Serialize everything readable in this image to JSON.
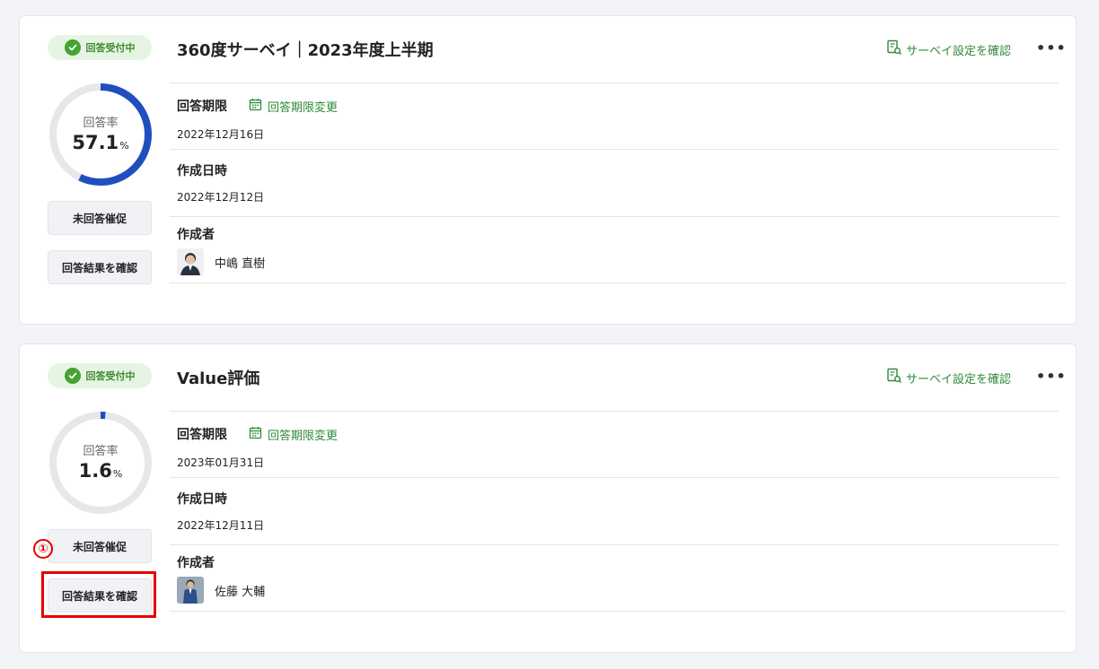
{
  "surveys": [
    {
      "status": "回答受付中",
      "title": "360度サーベイ｜2023年度上半期",
      "settings_link": "サーベイ設定を確認",
      "response_rate_label": "回答率",
      "response_rate_value": "57.1",
      "response_rate_unit": "%",
      "response_rate_fraction": 0.571,
      "remind_button": "未回答催促",
      "results_button": "回答結果を確認",
      "deadline_label": "回答期限",
      "deadline_change": "回答期限変更",
      "deadline_value": "2022年12月16日",
      "created_label": "作成日時",
      "created_value": "2022年12月12日",
      "creator_label": "作成者",
      "creator_name": "中嶋 直樹"
    },
    {
      "status": "回答受付中",
      "title": "Value評価",
      "settings_link": "サーベイ設定を確認",
      "response_rate_label": "回答率",
      "response_rate_value": "1.6",
      "response_rate_unit": "%",
      "response_rate_fraction": 0.016,
      "remind_button": "未回答催促",
      "results_button": "回答結果を確認",
      "deadline_label": "回答期限",
      "deadline_change": "回答期限変更",
      "deadline_value": "2023年01月31日",
      "created_label": "作成日時",
      "created_value": "2022年12月11日",
      "creator_label": "作成者",
      "creator_name": "佐藤 大輔"
    }
  ],
  "annotation": {
    "marker": "①"
  },
  "colors": {
    "accent_green": "#2f8a3a",
    "donut_progress": "#1f4fbf",
    "donut_track": "#e6e7eb",
    "highlight_red": "#e60000"
  },
  "icons": {
    "status": "check-circle-icon",
    "settings": "document-search-icon",
    "deadline": "calendar-icon",
    "more": "more-horizontal-icon"
  }
}
